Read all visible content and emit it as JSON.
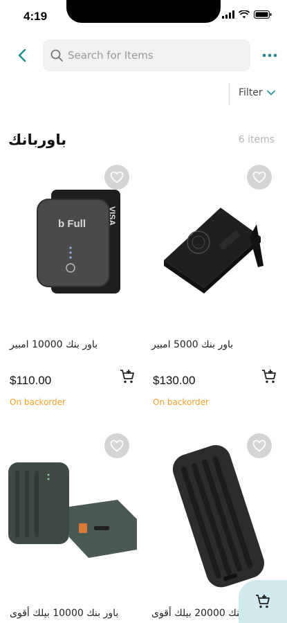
{
  "status_bar": {
    "time": "4:19"
  },
  "header": {
    "search_placeholder": "Search for Items"
  },
  "filter": {
    "label": "Filter"
  },
  "category": {
    "title": "باوربانك",
    "count": "6 items"
  },
  "products": [
    {
      "name": "باور بنك 10000 امبير",
      "price": "$110.00",
      "stock": "On backorder"
    },
    {
      "name": "باور بنك 5000 امبير",
      "price": "$130.00",
      "stock": "On backorder"
    },
    {
      "name": "باور بنك 10000 بيلك أقوى",
      "price": "",
      "stock": ""
    },
    {
      "name": "باور بنك 20000 بيلك أقوى",
      "price": "",
      "stock": ""
    }
  ],
  "colors": {
    "accent": "#1f8a8f",
    "stock": "#f0a12c",
    "fab": "#cfe9ec"
  },
  "icons": {
    "back": "chevron-left-icon",
    "search": "search-icon",
    "more": "more-horizontal-icon",
    "filter": "chevron-down-icon",
    "favorite": "heart-icon",
    "add_to_cart": "cart-plus-icon"
  }
}
